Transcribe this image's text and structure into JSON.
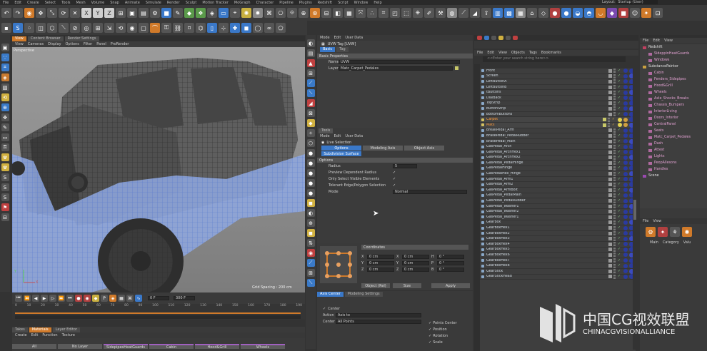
{
  "app": {
    "menubar": [
      "File",
      "Edit",
      "Create",
      "Select",
      "Tools",
      "Mesh",
      "Volume",
      "Snap",
      "Animate",
      "Simulate",
      "Render",
      "Sculpt",
      "Motion Tracker",
      "MoGraph",
      "Character",
      "Pipeline",
      "Plugins",
      "Redshift",
      "Script",
      "Window",
      "Help"
    ],
    "layout_label": "Layout:",
    "layout_value": "Startup (User)"
  },
  "viewport": {
    "tabs": [
      "View",
      "Cameras",
      "Display",
      "Options",
      "Filter",
      "Panel",
      "ProRender"
    ],
    "top_tabs": [
      "View",
      "Content Browser",
      "Render Settings"
    ],
    "label": "Perspective",
    "grid_spacing": "Grid Spacing : 200 cm",
    "axes": [
      "Y",
      "X",
      "Z"
    ]
  },
  "attributes": {
    "menu": [
      "Mode",
      "Edit",
      "User Data"
    ],
    "tag_title": "UVW Tag [UVW]",
    "tabs": [
      "Basic",
      "Tag"
    ],
    "section": "Basic Properties",
    "rows": [
      {
        "label": "Name",
        "value": "UVW"
      },
      {
        "label": "Layer",
        "value": "Matc_Carpet_Pedales"
      }
    ]
  },
  "tools": {
    "header": "Tools",
    "menu": [
      "Mode",
      "Edit",
      "User Data"
    ],
    "tool_name": "Live Selection",
    "tabs": [
      "Options",
      "Modeling Axis",
      "Object Axis"
    ],
    "subtab": "Subdivision Surface",
    "section": "Options",
    "radius_label": "Radius",
    "radius_value": "5",
    "checks": [
      "Preview Dependent Radius",
      "Only Select Visible Elements",
      "Tolerant Edge/Polygon Selection"
    ],
    "mode_label": "Mode",
    "mode_value": "Normal"
  },
  "coords": {
    "header": "Coordinates",
    "rows": [
      {
        "a": "X",
        "b": "0 cm",
        "c": "X",
        "d": "0 cm",
        "e": "H",
        "f": "0 °"
      },
      {
        "a": "Y",
        "b": "0 cm",
        "c": "Y",
        "d": "0 cm",
        "e": "P",
        "f": "0 °"
      },
      {
        "a": "Z",
        "b": "0 cm",
        "c": "Z",
        "d": "0 cm",
        "e": "B",
        "f": "0 °"
      }
    ],
    "object_label": "Object (Rel)",
    "size_label": "Size",
    "apply": "Apply"
  },
  "axis_center": {
    "tabs": [
      "Axis Center",
      "Modeling Settings"
    ],
    "center_label": "Center",
    "action_label": "Action",
    "action_value": "Axis to",
    "center_field_label": "Center",
    "center_value": "All Points",
    "points_center": "Points Center",
    "checks": [
      "Position",
      "Rotation",
      "Scale"
    ]
  },
  "objects": {
    "menu": [
      "File",
      "Edit",
      "View",
      "Objects",
      "Tags",
      "Bookmarks"
    ],
    "search_placeholder": "<<Enter your search string here>>",
    "items": [
      "Front",
      "Screen",
      "LeftButtonA",
      "LeftButtonB",
      "tButtons",
      "DialBack",
      "TopStrip",
      "ButtonStrip",
      "BottomButtons",
      "Carpet",
      "Mats",
      "BreakPedal_Arm",
      "BrakePedal_PedalRubber",
      "BrakePedal_Main",
      "GasPedal_Arch",
      "GasPedal_ArchHex1",
      "GasPedal_ArchHex2",
      "GasPedal_PedalHinge",
      "GasPedalHinge",
      "GasPedalHex_Hinge",
      "GasPedal_Arm1",
      "GasPedal_Arm2",
      "GasPedal_ArmBolt",
      "GasPedal_PedalMain",
      "GasPedal_PedalRubber",
      "GasPedal_Washer1",
      "GasPedal_Washer2",
      "GasPedal_Washer1",
      "Gearbox",
      "GearboxHex1",
      "GearboxHex2",
      "GearboxHex3",
      "GearboxHex4",
      "GearboxHex5",
      "GearboxHex6",
      "GearboxHex7",
      "GearboxHex8",
      "GearStick",
      "GearStickHead"
    ],
    "selected_indices": [
      9,
      10
    ]
  },
  "takes": {
    "menu": [
      "File",
      "Edit",
      "View"
    ],
    "items": [
      {
        "name": "Redshift",
        "color": "#c04060"
      },
      {
        "name": "SideppinHeatGuards",
        "color": "#b06aa0"
      },
      {
        "name": "Windows",
        "color": "#b06aa0"
      },
      {
        "name": "SubstancePainter",
        "color": "#c8a040"
      },
      {
        "name": "Cabin",
        "color": "#b06aa0"
      },
      {
        "name": "Fenders_Sidepipes",
        "color": "#b06aa0"
      },
      {
        "name": "Hood&Grill",
        "color": "#b06aa0"
      },
      {
        "name": "Wheels",
        "color": "#b06aa0"
      },
      {
        "name": "Axle_Shocks_Breaks",
        "color": "#b06aa0"
      },
      {
        "name": "Chassis_Bumpers",
        "color": "#b06aa0"
      },
      {
        "name": "InteriorLiving",
        "color": "#b06aa0"
      },
      {
        "name": "Doors_Interior",
        "color": "#b06aa0"
      },
      {
        "name": "CentralPanel",
        "color": "#b06aa0"
      },
      {
        "name": "Seats",
        "color": "#b06aa0"
      },
      {
        "name": "Matc_Carpet_Pedales",
        "color": "#b06aa0"
      },
      {
        "name": "Dash",
        "color": "#b06aa0"
      },
      {
        "name": "Attest",
        "color": "#b06aa0"
      },
      {
        "name": "Lights",
        "color": "#b06aa0"
      },
      {
        "name": "PeopAllesons",
        "color": "#b06aa0"
      },
      {
        "name": "Handles",
        "color": "#b06aa0"
      },
      {
        "name": "Scene",
        "color": "#9a4ab0"
      }
    ]
  },
  "bottom_right": {
    "menu": [
      "File",
      "View"
    ],
    "cols": [
      "Main",
      "Category",
      "Valu"
    ]
  },
  "timeline": {
    "numbers": [
      "0",
      "10",
      "20",
      "30",
      "40",
      "50",
      "60",
      "70",
      "80",
      "90",
      "100",
      "110",
      "120",
      "130",
      "140",
      "150",
      "160",
      "170",
      "180",
      "190"
    ],
    "frame_value": "0 F",
    "end_value": "300 F"
  },
  "layers": {
    "tabs": [
      "Takes",
      "Materials",
      "Layer Editor"
    ],
    "menu": [
      "Create",
      "Edit",
      "Function",
      "Texture"
    ],
    "strip": [
      "All",
      "No Layer",
      "SidepipesHeatGuards",
      "Cabin",
      "Hood&Grill",
      "Wheels"
    ]
  },
  "watermark": {
    "cn": "中国CG视效联盟",
    "en": "CHINACGVISIONALLIANCE"
  },
  "colors": {
    "accent": "#d07a2a",
    "blue": "#3a78c8",
    "bg": "#333333"
  }
}
